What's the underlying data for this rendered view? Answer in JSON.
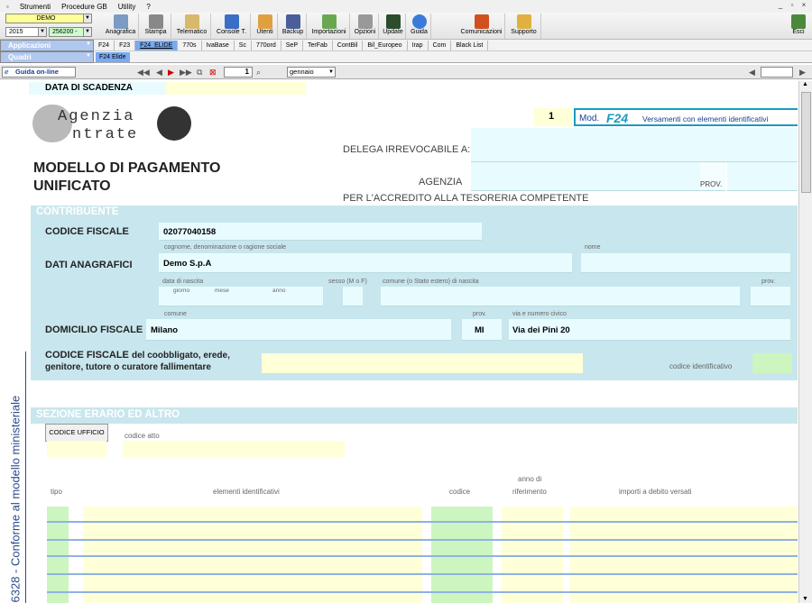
{
  "menu": [
    "Strumenti",
    "Procedure GB",
    "Utility",
    "?"
  ],
  "selectors": {
    "company": "DEMO",
    "year": "2015",
    "code": "256200 -",
    "applications": "Applicazioni",
    "panels": "Quadri"
  },
  "toolbar": [
    "Anagrafica",
    "Stampa",
    "Telematico",
    "Console T.",
    "Utenti",
    "Backup",
    "Importazioni",
    "Opzioni",
    "Update",
    "Guida",
    "Comunicazioni",
    "Supporto",
    "Esci"
  ],
  "tabs": [
    "F24",
    "F23",
    "F24_ELIDE",
    "770s",
    "IvaBase",
    "Sc",
    "770ord",
    "SeP",
    "TerFab",
    "ContBil",
    "Bil_Europeo",
    "Irap",
    "Com",
    "Black List"
  ],
  "active_tab": "F24_ELIDE",
  "subtab": "F24 Elide",
  "nav": {
    "guide_label": "Guida on-line",
    "page": "1",
    "month": "gennaio"
  },
  "form": {
    "scadenza_label": "DATA DI SCADENZA",
    "agency_line1": "Agenzia",
    "agency_line2": "ntrate",
    "page_number": "1",
    "mod_prefix": "Mod.",
    "mod_code": "F24",
    "mod_desc": "Versamenti con elementi identificativi",
    "delega": "DELEGA IRREVOCABILE A:",
    "agenzia": "AGENZIA",
    "prov": "PROV.",
    "accredito": "PER L'ACCREDITO ALLA TESORERIA COMPETENTE",
    "title1": "MODELLO DI PAGAMENTO",
    "title2": "UNIFICATO",
    "contribuente": "CONTRIBUENTE",
    "cf_label": "CODICE FISCALE",
    "cf_value": "02077040158",
    "dati_label": "DATI ANAGRAFICI",
    "cognome_hint": "cognome, denominazione o ragione sociale",
    "nome_hint": "nome",
    "ragione_sociale": "Demo S.p.A",
    "data_nascita_hint": "data di nascita",
    "giorno": "giorno",
    "mese": "mese",
    "anno": "anno",
    "sesso_hint": "sesso (M o F)",
    "comune_nascita_hint": "comune (o Stato estero) di nascita",
    "prov_hint": "prov.",
    "domicilio_label": "DOMICILIO FISCALE",
    "comune_hint": "comune",
    "via_hint": "via e numero civico",
    "comune": "Milano",
    "provincia": "MI",
    "via": "Via dei Pini 20",
    "coobbligato_bold": "CODICE FISCALE",
    "coobbligato_rest": "del coobbligato, erede,",
    "coobbligato_line2": "genitore, tutore o curatore fallimentare",
    "codice_id_hint": "codice identificativo",
    "sezione_erario": "SEZIONE ERARIO ED ALTRO",
    "codice_ufficio_btn": "CODICE UFFICIO",
    "codice_atto_hint": "codice atto",
    "col_tipo": "tipo",
    "col_elementi": "elementi identificativi",
    "col_codice": "codice",
    "col_anno1": "anno di",
    "col_anno2": "riferimento",
    "col_importi": "importi a debito versati",
    "side_text": "6328 - Conforme al modello ministeriale"
  },
  "colors": {
    "band": "#c8e6ed",
    "field": "#e8fcff",
    "yellow": "#ffffd8",
    "green": "#ccf5c0",
    "accent": "#1a9bbf"
  }
}
